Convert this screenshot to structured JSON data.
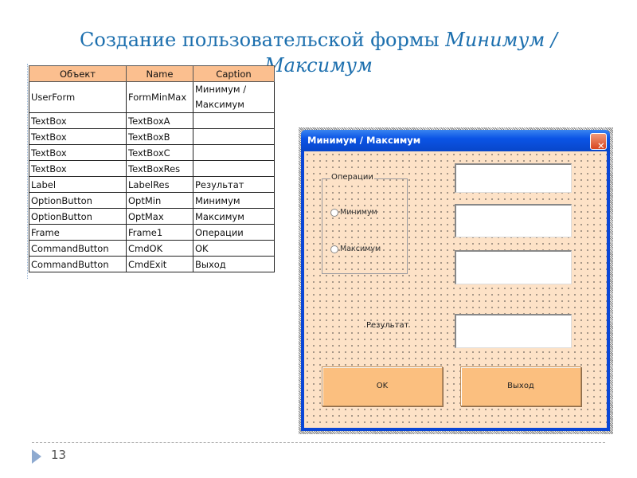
{
  "slide": {
    "title_part1": "Создание пользовательской формы ",
    "title_italic": "Минимум / Максимум",
    "page_number": "13"
  },
  "table": {
    "headers": [
      "Объект",
      "Name",
      "Caption"
    ],
    "rows": [
      [
        "UserForm",
        "FormMinMax",
        "Минимум / Максимум"
      ],
      [
        "TextBox",
        "TextBoxA",
        ""
      ],
      [
        "TextBox",
        "TextBoxB",
        ""
      ],
      [
        "TextBox",
        "TextBoxC",
        ""
      ],
      [
        "TextBox",
        "TextBoxRes",
        ""
      ],
      [
        "Label",
        "LabelRes",
        "Результат"
      ],
      [
        "OptionButton",
        "OptMin",
        "Минимум"
      ],
      [
        "OptionButton",
        "OptMax",
        "Максимум"
      ],
      [
        "Frame",
        "Frame1",
        "Операции"
      ],
      [
        "CommandButton",
        "CmdOK",
        "OK"
      ],
      [
        "CommandButton",
        "CmdExit",
        "Выход"
      ]
    ]
  },
  "form": {
    "title": "Минимум / Максимум",
    "close_glyph": "✕",
    "frame_label": "Операции",
    "opt_min": "Минимум",
    "opt_max": "Максимум",
    "result_label": "Результат",
    "ok_label": "OK",
    "exit_label": "Выход",
    "textbox_a": "",
    "textbox_b": "",
    "textbox_c": "",
    "textbox_res": ""
  }
}
